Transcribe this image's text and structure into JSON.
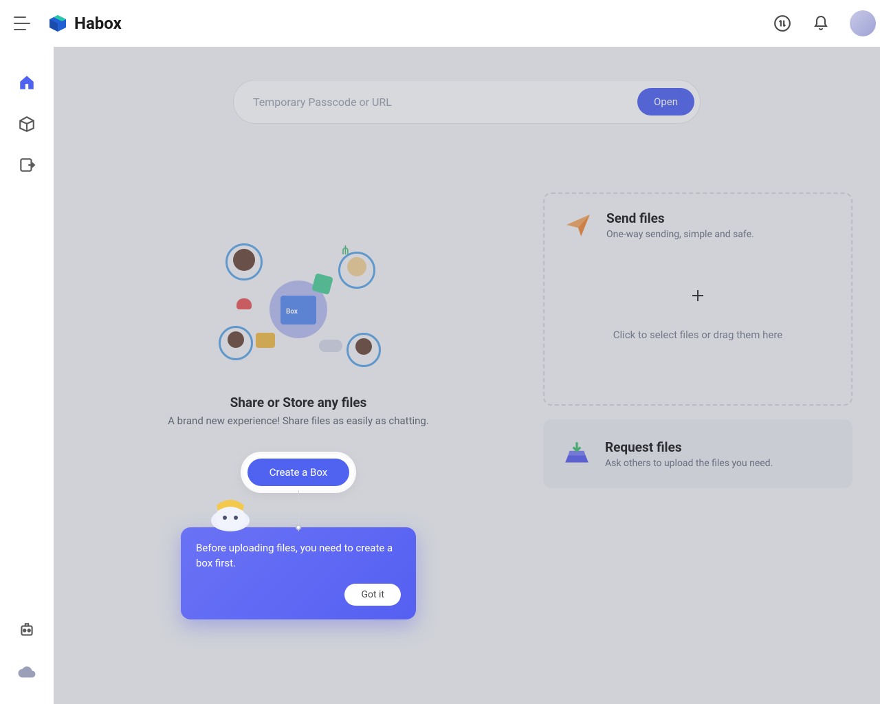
{
  "brand": {
    "name": "Habox"
  },
  "header": {
    "transfer_icon_title": "Transfers",
    "notifications_title": "Notifications"
  },
  "passcode": {
    "placeholder": "Temporary Passcode or URL",
    "open_label": "Open"
  },
  "hero": {
    "title": "Share or Store any files",
    "subtitle": "A brand new experience! Share files as easily as chatting.",
    "create_label": "Create a Box"
  },
  "send": {
    "title": "Send files",
    "subtitle": "One-way sending, simple and safe.",
    "drop_text": "Click to select files or drag them here"
  },
  "request": {
    "title": "Request files",
    "subtitle": "Ask others to upload the files you need."
  },
  "tooltip": {
    "message": "Before uploading files, you need to create a box first.",
    "gotit_label": "Got it"
  }
}
